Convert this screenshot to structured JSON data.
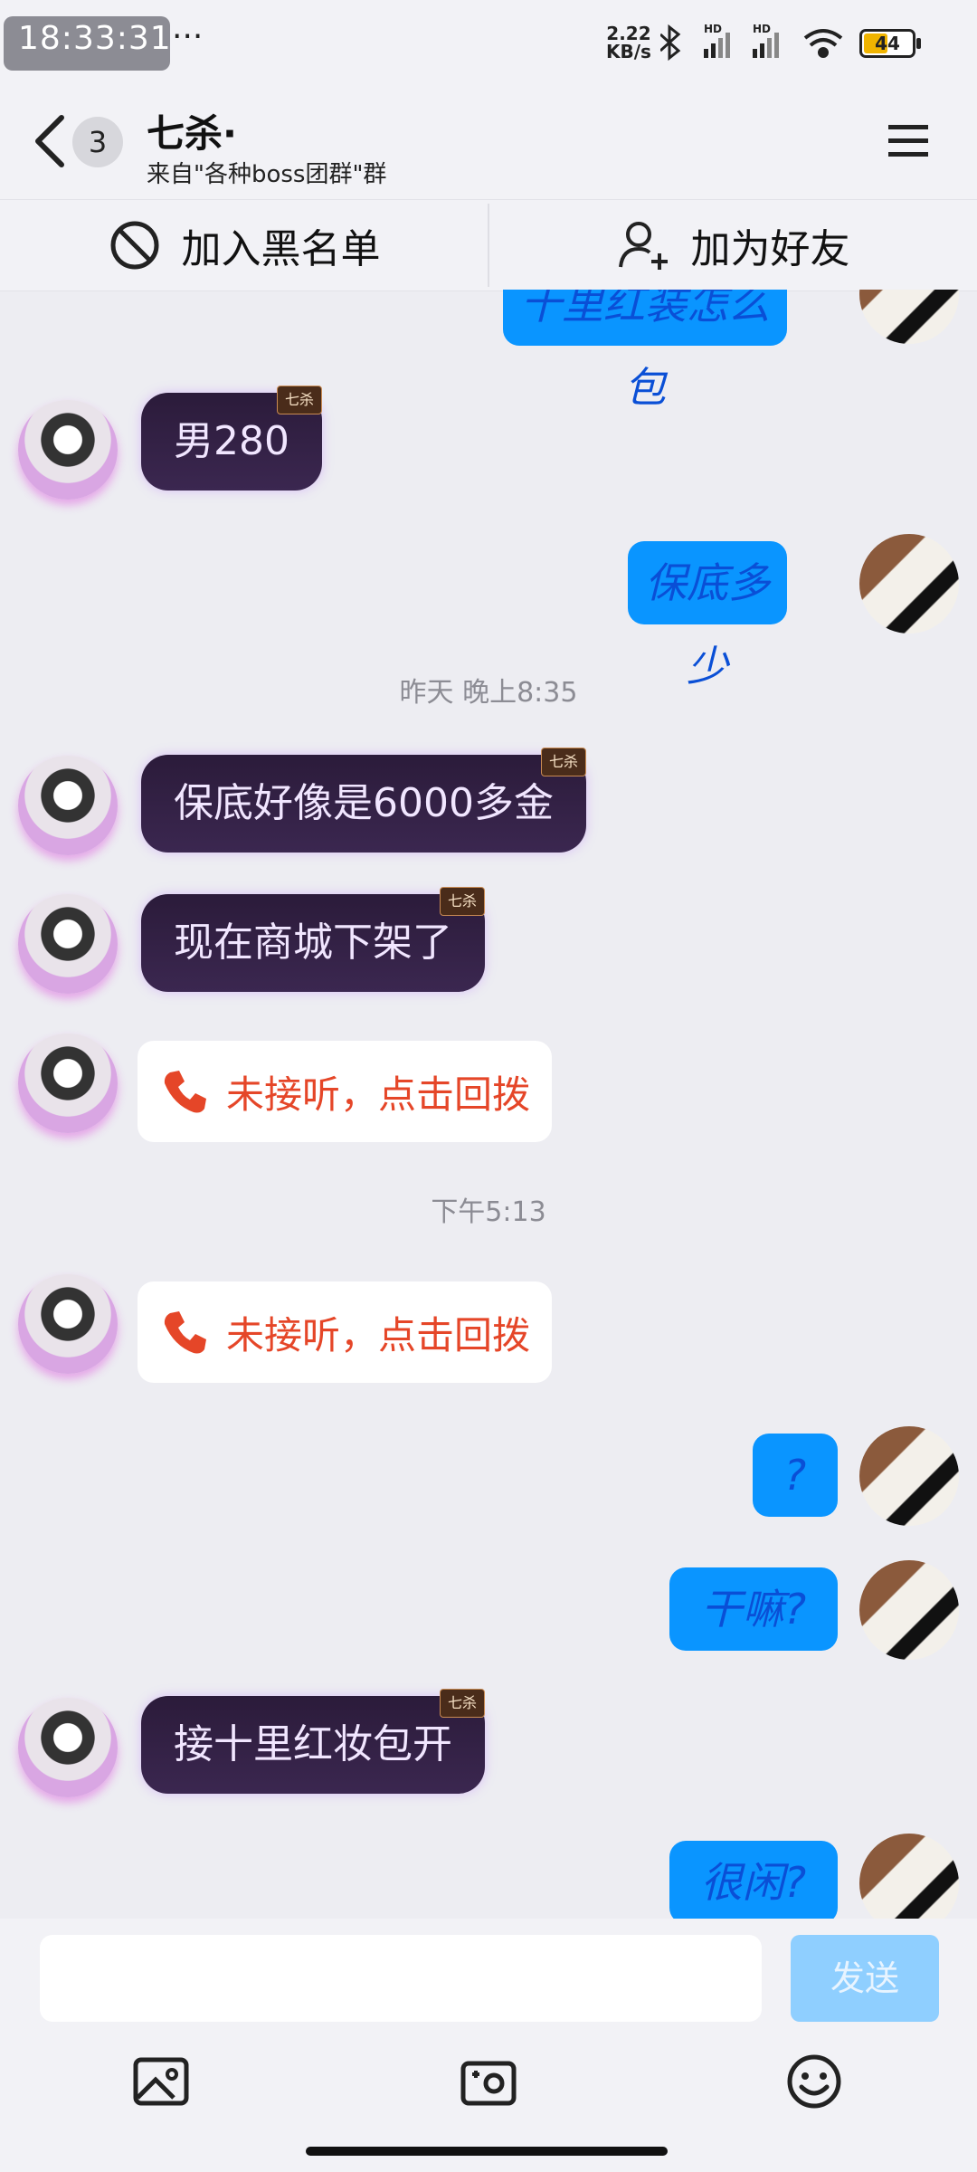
{
  "status_bar": {
    "time": "18:33:31",
    "menu_dots": "···",
    "network_speed_value": "2.22",
    "network_speed_unit": "KB/s",
    "signal_1": "HD",
    "signal_2": "HD",
    "battery": "44",
    "icons": [
      "bluetooth-icon",
      "signal-icon",
      "wifi-icon",
      "battery-icon"
    ]
  },
  "header": {
    "unread_count": "3",
    "title": "七杀·",
    "subtitle": "来自\"各种boss团群\"群",
    "back_icon": "chevron-left-icon",
    "menu_icon": "hamburger-menu-icon"
  },
  "actions": {
    "blacklist_label": "加入黑名单",
    "blacklist_icon": "block-icon",
    "add_friend_label": "加为好友",
    "add_friend_icon": "add-user-icon"
  },
  "messages": [
    {
      "from": "me",
      "text": "十里红装怎么包"
    },
    {
      "from": "other",
      "text": "男280",
      "tag": "七杀"
    },
    {
      "from": "me",
      "text": "保底多少"
    },
    {
      "type": "time",
      "text": "昨天 晚上8:35"
    },
    {
      "from": "other",
      "text": "保底好像是6000多金",
      "tag": "七杀"
    },
    {
      "from": "other",
      "text": "现在商城下架了",
      "tag": "七杀"
    },
    {
      "from": "other",
      "type": "call",
      "text": "未接听，点击回拨"
    },
    {
      "type": "time",
      "text": "下午5:13"
    },
    {
      "from": "other",
      "type": "call",
      "text": "未接听，点击回拨"
    },
    {
      "from": "me",
      "text": "?"
    },
    {
      "from": "me",
      "text": "干嘛?"
    },
    {
      "from": "other",
      "text": "接十里红妆包开",
      "tag": "七杀"
    },
    {
      "from": "me",
      "text": "很闲?"
    }
  ],
  "input": {
    "placeholder": "",
    "send_label": "发送"
  },
  "toolbar": {
    "icons": [
      "image-icon",
      "camera-icon",
      "emoji-icon"
    ]
  },
  "colors": {
    "accent_blue": "#0a95ff",
    "missed_call_red": "#e54628",
    "bubble_dark": "#2b1b3a",
    "send_disabled": "#8fcfff"
  }
}
